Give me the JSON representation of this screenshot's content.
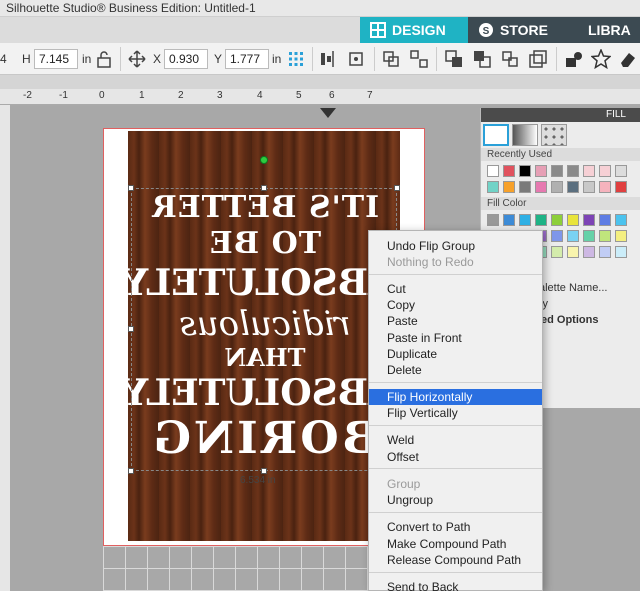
{
  "window": {
    "title": "Silhouette Studio® Business Edition: Untitled-1"
  },
  "tabs": [
    {
      "label": "DESIGN"
    },
    {
      "label": "STORE"
    },
    {
      "label": "LIBRA"
    }
  ],
  "toolbar": {
    "w_value_partial": "4",
    "h_label": "H",
    "h_value": "7.145",
    "h_unit": "in",
    "x_label": "X",
    "x_value": "0.930",
    "y_label": "Y",
    "y_value": "1.777",
    "y_unit": "in"
  },
  "ruler": {
    "numbers": [
      "-2",
      "-1",
      "0",
      "1",
      "2",
      "3",
      "4",
      "5",
      "6",
      "7"
    ]
  },
  "artwork": {
    "line1": "IT'S BETTER TO BE",
    "line2": "ABSOLUTELY",
    "line3": "ridiculous",
    "line4": "THAN",
    "line5": "ABSOLUTELY",
    "line6": "BORING",
    "dimension": "6.534 in"
  },
  "fill_panel": {
    "header": "FILL",
    "recently_used": "Recently Used",
    "fill_color": "Fill Color",
    "palette_label": "alette Name...",
    "transparency_label": "cy",
    "advanced_label": "ed Options"
  },
  "recent_colors": [
    "#ffffff",
    "#e0525e",
    "#000000",
    "#e69fb5",
    "#8a8a8a",
    "#8a8a8a",
    "#f6d0d5",
    "#f6d0d5",
    "#dcdcdc",
    "#71d3c7",
    "#f7a12a",
    "#7a7a7a",
    "#e679b0",
    "#b0b0b0",
    "#5b6f7f",
    "#c8c8c8",
    "#f5b3bd",
    "#e04040"
  ],
  "fill_colors": [
    "#999999",
    "#3d8bd6",
    "#2fb0e5",
    "#1fb386",
    "#8dcf3a",
    "#e8e43c",
    "#7d44b5",
    "#5e7de3",
    "#4cc3ee",
    "#38c48f",
    "#a8dc55",
    "#f0ea55",
    "#9a6cc8",
    "#7f96ea",
    "#7ad2f2",
    "#66d1a8",
    "#c0e57c",
    "#f4ef81",
    "#b08fd4",
    "#a1b2f0",
    "#a5e1f5",
    "#96debf",
    "#d4ecac",
    "#f8f4ad",
    "#cdb8e3",
    "#c1cdf5",
    "#cbedf9",
    "#c4ecd7",
    "#e8f3d2",
    "#fbf8d4"
  ],
  "context_menu": {
    "items": [
      {
        "label": "Undo Flip Group",
        "disabled": false
      },
      {
        "label": "Nothing to Redo",
        "disabled": true
      },
      {
        "label": "Cut",
        "disabled": false
      },
      {
        "label": "Copy",
        "disabled": false
      },
      {
        "label": "Paste",
        "disabled": false
      },
      {
        "label": "Paste in Front",
        "disabled": false
      },
      {
        "label": "Duplicate",
        "disabled": false
      },
      {
        "label": "Delete",
        "disabled": false
      },
      {
        "label": "Flip Horizontally",
        "disabled": false,
        "active": true
      },
      {
        "label": "Flip Vertically",
        "disabled": false
      },
      {
        "label": "Weld",
        "disabled": false
      },
      {
        "label": "Offset",
        "disabled": false
      },
      {
        "label": "Group",
        "disabled": true
      },
      {
        "label": "Ungroup",
        "disabled": false
      },
      {
        "label": "Convert to Path",
        "disabled": false
      },
      {
        "label": "Make Compound Path",
        "disabled": false
      },
      {
        "label": "Release Compound Path",
        "disabled": false
      },
      {
        "label": "Send to Back",
        "disabled": false
      }
    ]
  },
  "colors": {
    "accent": "#1fb3c4",
    "menu_highlight": "#2a6fe0",
    "dark_tab": "#3c4a52"
  }
}
